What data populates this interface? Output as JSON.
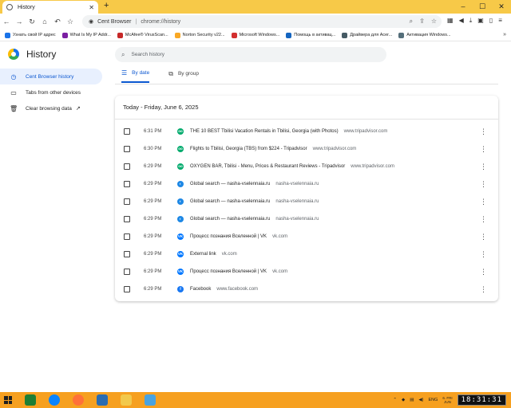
{
  "browser": {
    "tab_title": "History",
    "new_tab_symbol": "+",
    "omnibox": {
      "site": "Cent Browser",
      "url": "chrome://history"
    }
  },
  "bookmarks": [
    {
      "label": "Узнать свой IP адрес",
      "color": "#1a73e8"
    },
    {
      "label": "What Is My IP Addr...",
      "color": "#7b1fa2"
    },
    {
      "label": "McAfee® VirusScan...",
      "color": "#c62828"
    },
    {
      "label": "Norton Security v22...",
      "color": "#f9a825"
    },
    {
      "label": "Microsoft Windows...",
      "color": "#d32f2f"
    },
    {
      "label": "Помощь в активац...",
      "color": "#1565c0"
    },
    {
      "label": "Драйвера для Acer...",
      "color": "#455a64"
    },
    {
      "label": "Активация Windows...",
      "color": "#546e7a"
    }
  ],
  "page": {
    "title": "History",
    "search_placeholder": "Search history",
    "sidebar": [
      {
        "label": "Cent Browser history",
        "icon": "clock-icon"
      },
      {
        "label": "Tabs from other devices",
        "icon": "devices-icon"
      },
      {
        "label": "Clear browsing data",
        "icon": "trash-icon"
      }
    ],
    "view_tabs": [
      {
        "label": "By date",
        "icon": "list-icon"
      },
      {
        "label": "By group",
        "icon": "group-icon"
      }
    ],
    "date_heading": "Today - Friday, June 6, 2025",
    "entries": [
      {
        "time": "6:31 PM",
        "title": "THE 10 BEST Tbilisi Vacation Rentals in Tbilisi, Georgia (with Photos)",
        "domain": "www.tripadvisor.com",
        "favicon": "tripadvisor-icon",
        "color": "#00aa6c",
        "glyph": "oo"
      },
      {
        "time": "6:30 PM",
        "title": "Flights to Tbilisi, Georgia (TBS) from $224 - Tripadvisor",
        "domain": "www.tripadvisor.com",
        "favicon": "tripadvisor-icon",
        "color": "#00aa6c",
        "glyph": "oo"
      },
      {
        "time": "6:29 PM",
        "title": "OXYGEN BAR, Tbilisi - Menu, Prices & Restaurant Reviews - Tripadvisor",
        "domain": "www.tripadvisor.com",
        "favicon": "tripadvisor-icon",
        "color": "#00aa6c",
        "glyph": "oo"
      },
      {
        "time": "6:29 PM",
        "title": "Global search — nasha-vselennaia.ru",
        "domain": "nasha-vselennaia.ru",
        "favicon": "site-icon",
        "color": "#1e88e5",
        "glyph": "◐"
      },
      {
        "time": "6:29 PM",
        "title": "Global search — nasha-vselennaia.ru",
        "domain": "nasha-vselennaia.ru",
        "favicon": "site-icon",
        "color": "#1e88e5",
        "glyph": "◐"
      },
      {
        "time": "6:29 PM",
        "title": "Global search — nasha-vselennaia.ru",
        "domain": "nasha-vselennaia.ru",
        "favicon": "site-icon",
        "color": "#1e88e5",
        "glyph": "◐"
      },
      {
        "time": "6:29 PM",
        "title": "Процесс познания Вселенной | VK",
        "domain": "vk.com",
        "favicon": "vk-icon",
        "color": "#0077ff",
        "glyph": "VK"
      },
      {
        "time": "6:29 PM",
        "title": "External link",
        "domain": "vk.com",
        "favicon": "vk-icon",
        "color": "#0077ff",
        "glyph": "VK"
      },
      {
        "time": "6:29 PM",
        "title": "Процесс познания Вселенной | VK",
        "domain": "vk.com",
        "favicon": "vk-icon",
        "color": "#0077ff",
        "glyph": "VK"
      },
      {
        "time": "6:29 PM",
        "title": "Facebook",
        "domain": "www.facebook.com",
        "favicon": "facebook-icon",
        "color": "#1877f2",
        "glyph": "f"
      }
    ]
  },
  "taskbar": {
    "language": "ENG",
    "date_line1": "6. FRI",
    "date_line2": "JUN",
    "clock": "18:31:31",
    "apps": [
      {
        "name": "excel-app",
        "color": "#1e7e34"
      },
      {
        "name": "edge-app",
        "color": "#0a84ff"
      },
      {
        "name": "firefox-app",
        "color": "#ff7139"
      },
      {
        "name": "cent-browser-app",
        "color": "#2b6cb0"
      },
      {
        "name": "file-explorer-app",
        "color": "#f2c94c"
      },
      {
        "name": "generic-app",
        "color": "#4aa3df"
      }
    ]
  }
}
